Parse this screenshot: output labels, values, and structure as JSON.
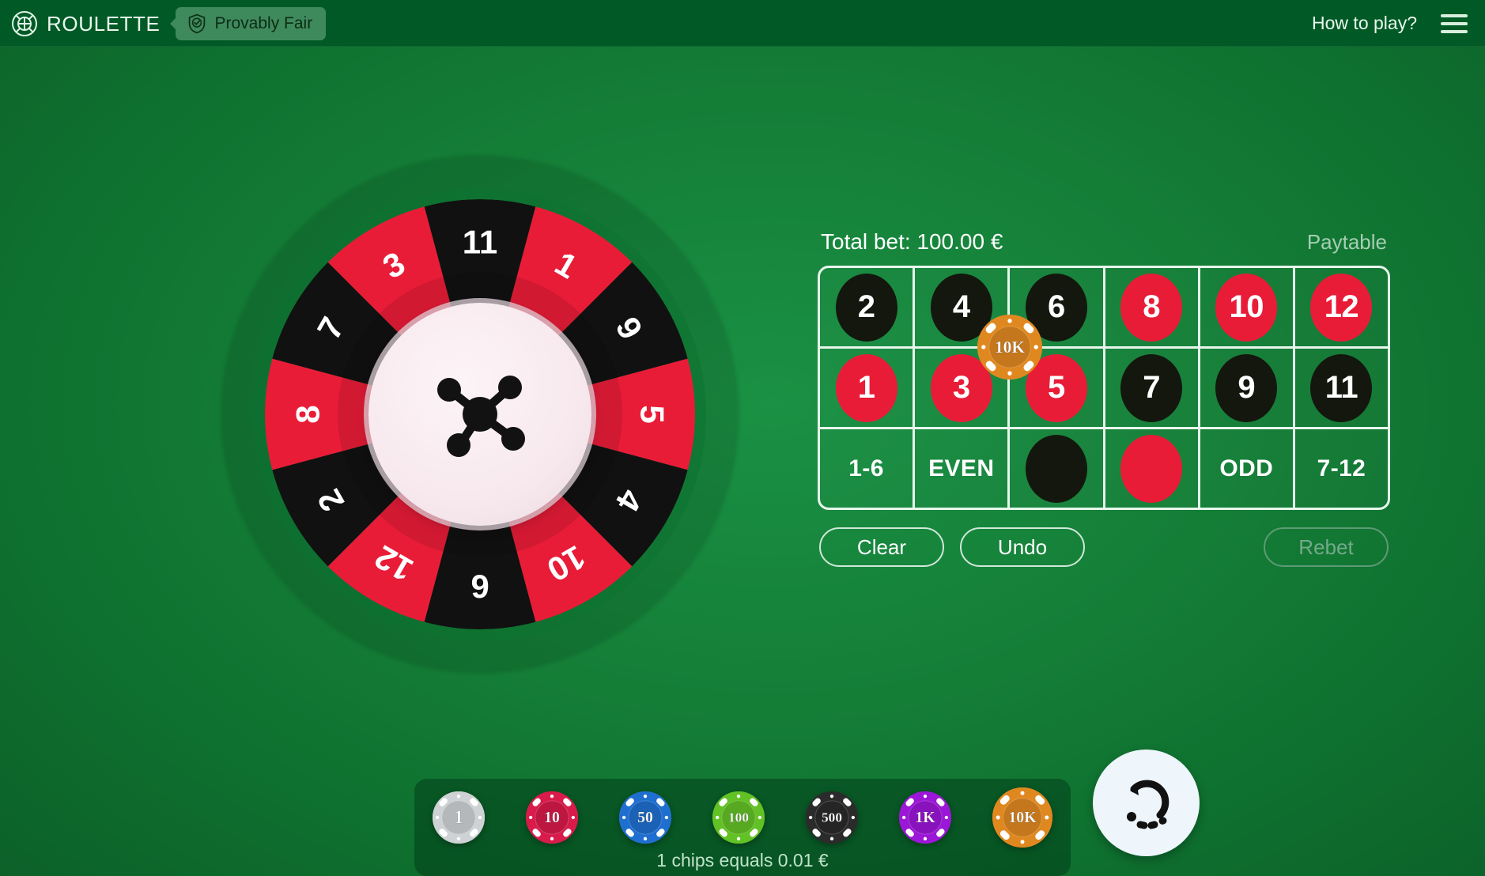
{
  "header": {
    "brand_icon": "roulette-target-icon",
    "brand": "ROULETTE",
    "provably_fair": "Provably Fair",
    "provably_fair_icon": "shield-check-icon",
    "how_to_play": "How to play?",
    "menu_icon": "hamburger-menu-icon"
  },
  "wheel": {
    "center_logo_icon": "molecule-logo-icon",
    "segments": [
      {
        "number": "11",
        "color": "black"
      },
      {
        "number": "1",
        "color": "red"
      },
      {
        "number": "9",
        "color": "black"
      },
      {
        "number": "5",
        "color": "red"
      },
      {
        "number": "4",
        "color": "black"
      },
      {
        "number": "10",
        "color": "red"
      },
      {
        "number": "6",
        "color": "black"
      },
      {
        "number": "12",
        "color": "red"
      },
      {
        "number": "2",
        "color": "black"
      },
      {
        "number": "8",
        "color": "red"
      },
      {
        "number": "7",
        "color": "black"
      },
      {
        "number": "3",
        "color": "red"
      }
    ]
  },
  "bet_panel": {
    "total_bet_label": "Total bet: 100.00 €",
    "paytable_label": "Paytable",
    "rows": [
      [
        {
          "label": "2",
          "type": "number",
          "color": "black"
        },
        {
          "label": "4",
          "type": "number",
          "color": "black"
        },
        {
          "label": "6",
          "type": "number",
          "color": "black"
        },
        {
          "label": "8",
          "type": "number",
          "color": "red"
        },
        {
          "label": "10",
          "type": "number",
          "color": "red"
        },
        {
          "label": "12",
          "type": "number",
          "color": "red"
        }
      ],
      [
        {
          "label": "1",
          "type": "number",
          "color": "red"
        },
        {
          "label": "3",
          "type": "number",
          "color": "red"
        },
        {
          "label": "5",
          "type": "number",
          "color": "red"
        },
        {
          "label": "7",
          "type": "number",
          "color": "black"
        },
        {
          "label": "9",
          "type": "number",
          "color": "black"
        },
        {
          "label": "11",
          "type": "number",
          "color": "black"
        }
      ],
      [
        {
          "label": "1-6",
          "type": "outside",
          "color": "none"
        },
        {
          "label": "EVEN",
          "type": "outside",
          "color": "none"
        },
        {
          "label": "",
          "type": "color",
          "color": "black"
        },
        {
          "label": "",
          "type": "color",
          "color": "red"
        },
        {
          "label": "ODD",
          "type": "outside",
          "color": "none"
        },
        {
          "label": "7-12",
          "type": "outside",
          "color": "none"
        }
      ]
    ],
    "placed_chips": [
      {
        "label": "10K",
        "color": "#e08820",
        "row": 0,
        "corner": "between-4-6-3-5"
      }
    ],
    "actions": {
      "clear": "Clear",
      "undo": "Undo",
      "rebet": "Rebet",
      "rebet_disabled": true
    }
  },
  "chip_tray": {
    "hint": "1 chips equals 0.01 €",
    "selected": "10K",
    "chips": [
      {
        "label": "1",
        "color": "#cfd2d4",
        "ring": "#e9ecee",
        "selected": false
      },
      {
        "label": "10",
        "color": "#d81b4b",
        "ring": "#ee2f5d",
        "selected": false
      },
      {
        "label": "50",
        "color": "#1f6fd0",
        "ring": "#2f86e8",
        "selected": false
      },
      {
        "label": "100",
        "color": "#62c125",
        "ring": "#78d93a",
        "selected": false
      },
      {
        "label": "500",
        "color": "#2b2b2b",
        "ring": "#3c3c3c",
        "selected": false
      },
      {
        "label": "1K",
        "color": "#9b16d6",
        "ring": "#ad2de8",
        "selected": false
      },
      {
        "label": "10K",
        "color": "#e08820",
        "ring": "#f09c2e",
        "selected": true
      }
    ],
    "spin_button_icon": "spin-refresh-icon"
  },
  "colors": {
    "table_green": "#158038",
    "header_green": "#015a26",
    "red": "#e91c38",
    "black": "#14170e",
    "line": "#e7f6ec"
  }
}
